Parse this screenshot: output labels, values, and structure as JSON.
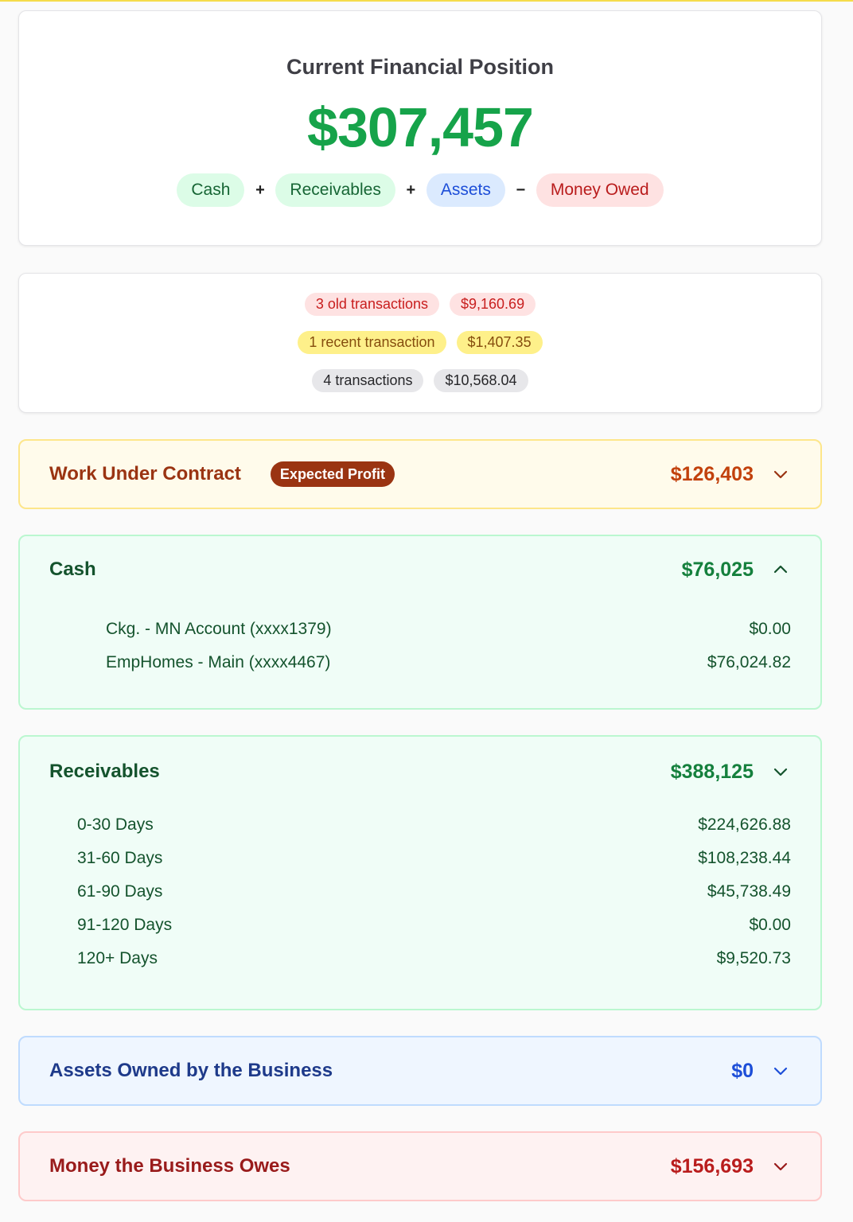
{
  "summary": {
    "title": "Current Financial Position",
    "total": "$307,457",
    "formula": {
      "cash": "Cash",
      "plus1": "+",
      "receivables": "Receivables",
      "plus2": "+",
      "assets": "Assets",
      "minus": "−",
      "owed": "Money Owed"
    }
  },
  "transactions": {
    "old": {
      "label": "3 old transactions",
      "amount": "$9,160.69"
    },
    "recent": {
      "label": "1 recent transaction",
      "amount": "$1,407.35"
    },
    "total": {
      "label": "4 transactions",
      "amount": "$10,568.04"
    }
  },
  "work_under_contract": {
    "title": "Work Under Contract",
    "badge": "Expected Profit",
    "amount": "$126,403",
    "chevron": "chevron-down-icon"
  },
  "cash": {
    "title": "Cash",
    "amount": "$76,025",
    "chevron": "chevron-up-icon",
    "accounts": [
      {
        "name": "Ckg. - MN Account (xxxx1379)",
        "amount": "$0.00"
      },
      {
        "name": "EmpHomes - Main (xxxx4467)",
        "amount": "$76,024.82"
      }
    ]
  },
  "receivables": {
    "title": "Receivables",
    "amount": "$388,125",
    "chevron": "chevron-down-icon",
    "buckets": [
      {
        "name": "0-30 Days",
        "amount": "$224,626.88"
      },
      {
        "name": "31-60 Days",
        "amount": "$108,238.44"
      },
      {
        "name": "61-90 Days",
        "amount": "$45,738.49"
      },
      {
        "name": "91-120 Days",
        "amount": "$0.00"
      },
      {
        "name": "120+ Days",
        "amount": "$9,520.73"
      }
    ]
  },
  "assets": {
    "title": "Assets Owned by the Business",
    "amount": "$0",
    "chevron": "chevron-down-icon"
  },
  "owes": {
    "title": "Money the Business Owes",
    "amount": "$156,693",
    "chevron": "chevron-down-icon"
  },
  "colors": {
    "green": "#16a34a",
    "blue": "#1d4ed8",
    "red": "#b91c1c",
    "orange": "#c2410c"
  }
}
